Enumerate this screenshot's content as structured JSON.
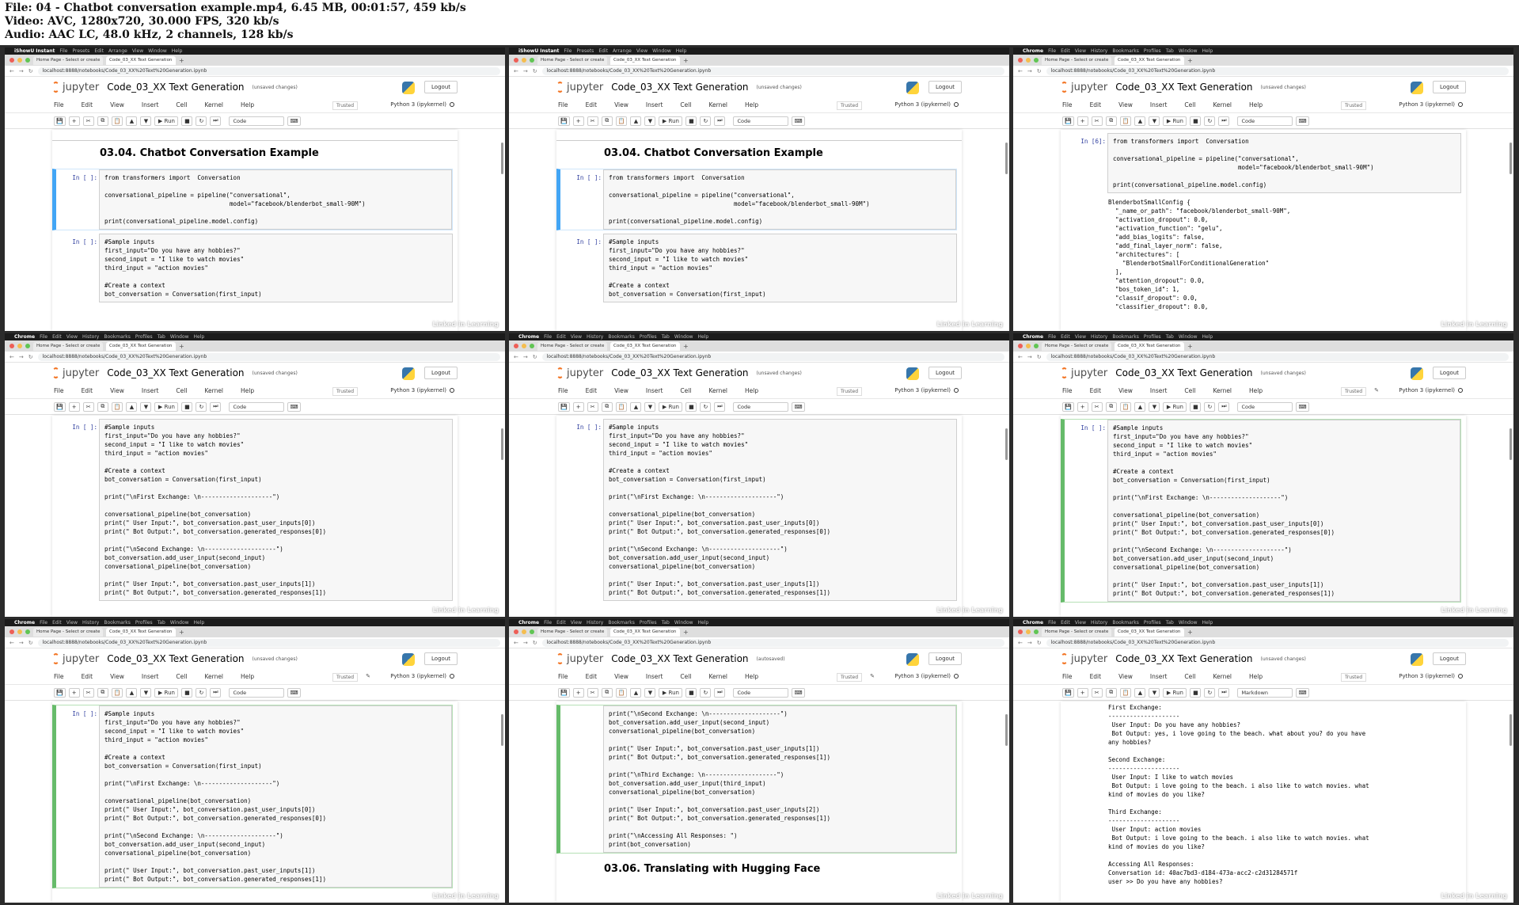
{
  "file_info": [
    "File: 04 - Chatbot conversation example.mp4, 6.45 MB, 00:01:57, 459 kb/s",
    "Video: AVC, 1280x720, 30.000 FPS, 320 kb/s",
    "Audio: AAC LC, 48.0 kHz, 2 channels, 128 kb/s"
  ],
  "browser": {
    "app_a": "iShowU Instant",
    "app_b": "Chrome",
    "menus_a": [
      "File",
      "Presets",
      "Edit",
      "Arrange",
      "View",
      "Window",
      "Help"
    ],
    "menus_b": [
      "File",
      "Edit",
      "View",
      "History",
      "Bookmarks",
      "Profiles",
      "Tab",
      "Window",
      "Help"
    ],
    "tab1": "Home Page - Select or create",
    "tab2": "Code_03_XX Text Generation",
    "url": "localhost:8888/notebooks/Code_03_XX%20Text%20Generation.ipynb"
  },
  "jupyter": {
    "logo_text": "jupyter",
    "title": "Code_03_XX Text Generation",
    "status_unsaved": "(unsaved changes)",
    "status_autosaved": "(autosaved)",
    "logout": "Logout",
    "menu": [
      "File",
      "Edit",
      "View",
      "Insert",
      "Cell",
      "Kernel",
      "Help"
    ],
    "trusted": "Trusted",
    "kernel": "Python 3 (ipykernel)",
    "run": "▶ Run",
    "celltype_code": "Code",
    "celltype_markdown": "Markdown"
  },
  "watermark": "Linked in Learning",
  "prompt_empty": "In [ ]:",
  "prompt_6": "In [6]:",
  "heading_chatbot": "03.04. Chatbot Conversation Example",
  "heading_translate": "03.06. Translating with Hugging Face",
  "code_setup": "from transformers import  Conversation\n\nconversational_pipeline = pipeline(\"conversational\",\n                                   model=\"facebook/blenderbot_small-90M\")\n\nprint(conversational_pipeline.model.config)",
  "code_inputs_short": "#Sample inputs\nfirst_input=\"Do you have any hobbies?\"\nsecond_input = \"I like to watch movies\"\nthird_input = \"action movies\"\n\n#Create a context\nbot_conversation = Conversation(first_input)",
  "code_inputs_long": "#Sample inputs\nfirst_input=\"Do you have any hobbies?\"\nsecond_input = \"I like to watch movies\"\nthird_input = \"action movies\"\n\n#Create a context\nbot_conversation = Conversation(first_input)\n\nprint(\"\\nFirst Exchange: \\n--------------------\")\n\nconversational_pipeline(bot_conversation)\nprint(\" User Input:\", bot_conversation.past_user_inputs[0])\nprint(\" Bot Output:\", bot_conversation.generated_responses[0])\n\nprint(\"\\nSecond Exchange: \\n--------------------\")\nbot_conversation.add_user_input(second_input)\nconversational_pipeline(bot_conversation)\n\nprint(\" User Input:\", bot_conversation.past_user_inputs[1])\nprint(\" Bot Output:\", bot_conversation.generated_responses[1])",
  "code_tail": "print(\"\\nSecond Exchange: \\n--------------------\")\nbot_conversation.add_user_input(second_input)\nconversational_pipeline(bot_conversation)\n\nprint(\" User Input:\", bot_conversation.past_user_inputs[1])\nprint(\" Bot Output:\", bot_conversation.generated_responses[1])\n\nprint(\"\\nThird Exchange: \\n--------------------\")\nbot_conversation.add_user_input(third_input)\nconversational_pipeline(bot_conversation)\n\nprint(\" User Input:\", bot_conversation.past_user_inputs[2])\nprint(\" Bot Output:\", bot_conversation.generated_responses[1])\n\nprint(\"\\nAccessing All Responses: \")\nprint(bot_conversation)",
  "output_config": "BlenderbotSmallConfig {\n  \"_name_or_path\": \"facebook/blenderbot_small-90M\",\n  \"activation_dropout\": 0.0,\n  \"activation_function\": \"gelu\",\n  \"add_bias_logits\": false,\n  \"add_final_layer_norm\": false,\n  \"architectures\": [\n    \"BlenderbotSmallForConditionalGeneration\"\n  ],\n  \"attention_dropout\": 0.0,\n  \"bos_token_id\": 1,\n  \"classif_dropout\": 0.0,\n  \"classifier_dropout\": 0.0,",
  "output_conversation": "First Exchange:\n--------------------\n User Input: Do you have any hobbies?\n Bot Output: yes, i love going to the beach. what about you? do you have\nany hobbies?\n\nSecond Exchange:\n--------------------\n User Input: I like to watch movies\n Bot Output: i love going to the beach. i also like to watch movies. what\nkind of movies do you like?\n\nThird Exchange:\n--------------------\n User Input: action movies\n Bot Output: i love going to the beach. i also like to watch movies. what\nkind of movies do you like?\n\nAccessing All Responses:\nConversation id: 40ac7bd3-d184-473a-acc2-c2d31284571f\nuser >> Do you have any hobbies?"
}
